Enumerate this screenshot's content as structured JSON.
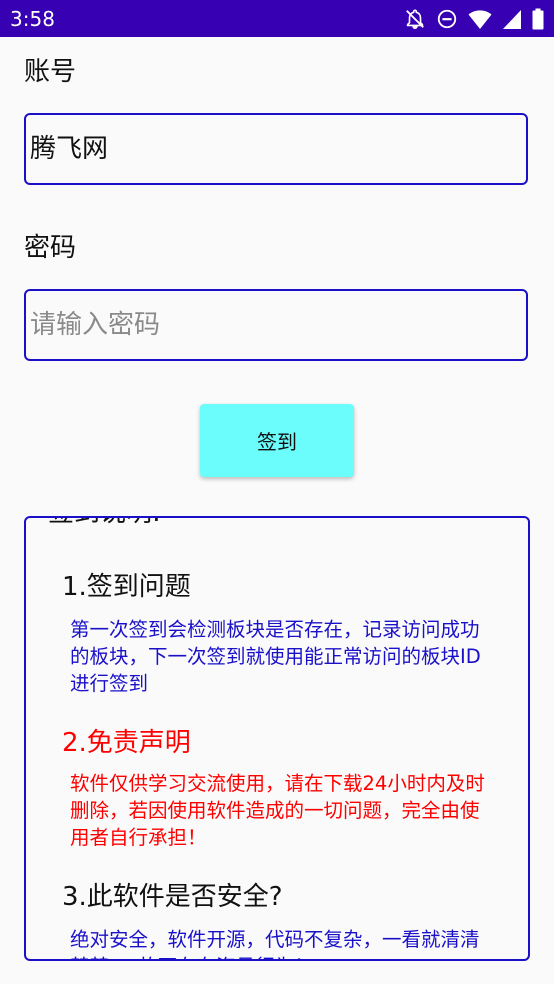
{
  "status_bar": {
    "time": "3:58",
    "icons": [
      "notifications-off-icon",
      "do-not-disturb-icon",
      "wifi-icon",
      "signal-icon",
      "battery-icon"
    ]
  },
  "form": {
    "account_label": "账号",
    "account_value": "腾飞网",
    "password_label": "密码",
    "password_placeholder": "请输入密码",
    "checkin_button": "签到"
  },
  "notice": {
    "title": "签到说明:",
    "sections": [
      {
        "title": "1.签到问题",
        "body": "第一次签到会检测板块是否存在，记录访问成功的板块，下一次签到就使用能正常访问的板块ID进行签到"
      },
      {
        "title": "2.免责声明",
        "body": "软件仅供学习交流使用，请在下载24小时内及时删除，若因使用软件造成的一切问题，完全由使用者自行承担！"
      },
      {
        "title": "3.此软件是否安全?",
        "body": "绝对安全，软件开源，代码不复杂，一看就清清楚楚，，故不存在盗号行为！"
      }
    ]
  },
  "colors": {
    "status_bar": "#3700b3",
    "border": "#1a10c8",
    "button": "#6bfcfc",
    "warning_text": "#ff0000",
    "info_text": "#1a10c8"
  }
}
